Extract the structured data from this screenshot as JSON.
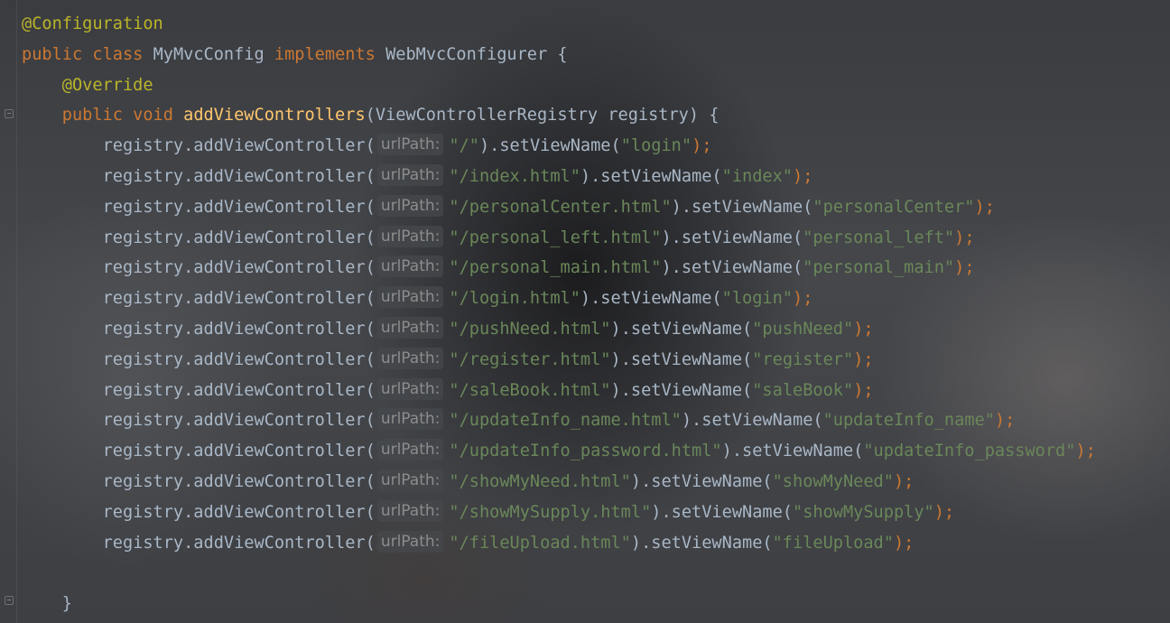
{
  "editor": {
    "annotation_class": "@Configuration",
    "class_decl": {
      "kw_public": "public",
      "kw_class": "class",
      "name": "MyMvcConfig",
      "kw_implements": "implements",
      "iface": "WebMvcConfigurer",
      "brace": " {"
    },
    "override": "@Override",
    "method_decl": {
      "kw_public": "public",
      "kw_void": "void",
      "name": "addViewControllers",
      "params": "(ViewControllerRegistry registry) {"
    },
    "call_prefix": "registry.addViewController(",
    "hint_label": "urlPath:",
    "set_call": ").setViewName(",
    "call_end": ");",
    "registrations": [
      {
        "path": "\"/\"",
        "view": "\"login\""
      },
      {
        "path": "\"/index.html\"",
        "view": "\"index\""
      },
      {
        "path": "\"/personalCenter.html\"",
        "view": "\"personalCenter\""
      },
      {
        "path": "\"/personal_left.html\"",
        "view": "\"personal_left\""
      },
      {
        "path": "\"/personal_main.html\"",
        "view": "\"personal_main\""
      },
      {
        "path": "\"/login.html\"",
        "view": "\"login\""
      },
      {
        "path": "\"/pushNeed.html\"",
        "view": "\"pushNeed\""
      },
      {
        "path": "\"/register.html\"",
        "view": "\"register\""
      },
      {
        "path": "\"/saleBook.html\"",
        "view": "\"saleBook\""
      },
      {
        "path": "\"/updateInfo_name.html\"",
        "view": "\"updateInfo_name\""
      },
      {
        "path": "\"/updateInfo_password.html\"",
        "view": "\"updateInfo_password\""
      },
      {
        "path": "\"/showMyNeed.html\"",
        "view": "\"showMyNeed\""
      },
      {
        "path": "\"/showMySupply.html\"",
        "view": "\"showMySupply\""
      },
      {
        "path": "\"/fileUpload.html\"",
        "view": "\"fileUpload\""
      }
    ],
    "closing_brace": "}"
  }
}
